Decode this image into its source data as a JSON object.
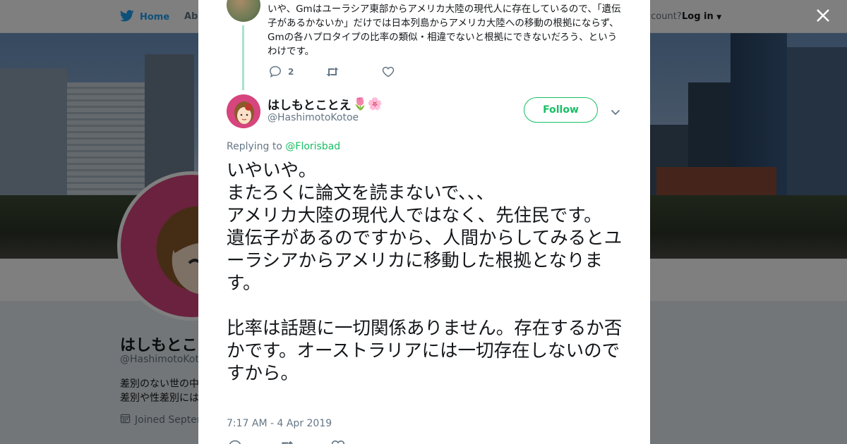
{
  "nav": {
    "home_label": "Home",
    "about_label": "Abo",
    "account_label": "ccount?",
    "login_label": "Log in"
  },
  "profile": {
    "name": "はしもとこ",
    "handle": "@HashimotoKotoe",
    "bio_line1": "差別のない世の中",
    "bio_line2": "差別や性差別には",
    "joined": "Joined Septem"
  },
  "previous_tweet": {
    "text": "いや、Gmはユーラシア東部からアメリカ大陸の現代人に存在しているので、「遺伝子があるかないか」だけでは日本列島からアメリカ大陸への移動の根拠にならず、Gmの各ハプロタイプの比率の類似・相違でないと根拠にできないだろう、というわけです。",
    "reply_count": "2",
    "retweet_count": "",
    "like_count": ""
  },
  "tweet": {
    "author_name": "はしもとことえ",
    "name_emojis": "🌷🌸",
    "author_handle": "@HashimotoKotoe",
    "follow_label": "Follow",
    "replying_prefix": "Replying to ",
    "replying_to": "@Florisbad",
    "text": "いやいや。\nまたろくに論文を読まないで、、、\nアメリカ大陸の現代人ではなく、先住民です。\n遺伝子があるのですから、人間からしてみるとユーラシアからアメリカに移動した根拠となります。\n\n比率は話題に一切関係ありません。存在するか否かです。オーストラリアには一切存在しないのですから。",
    "timestamp": "7:17 AM - 4 Apr 2019"
  },
  "icons": {
    "logo": "twitter-bird-icon",
    "close": "close-icon",
    "reply": "reply-icon",
    "retweet": "retweet-icon",
    "like": "heart-icon",
    "more": "chevron-down-icon",
    "calendar": "calendar-icon"
  },
  "colors": {
    "accent": "#17bf63",
    "brand": "#1da1f2",
    "thread_line": "#a8e2cf"
  }
}
